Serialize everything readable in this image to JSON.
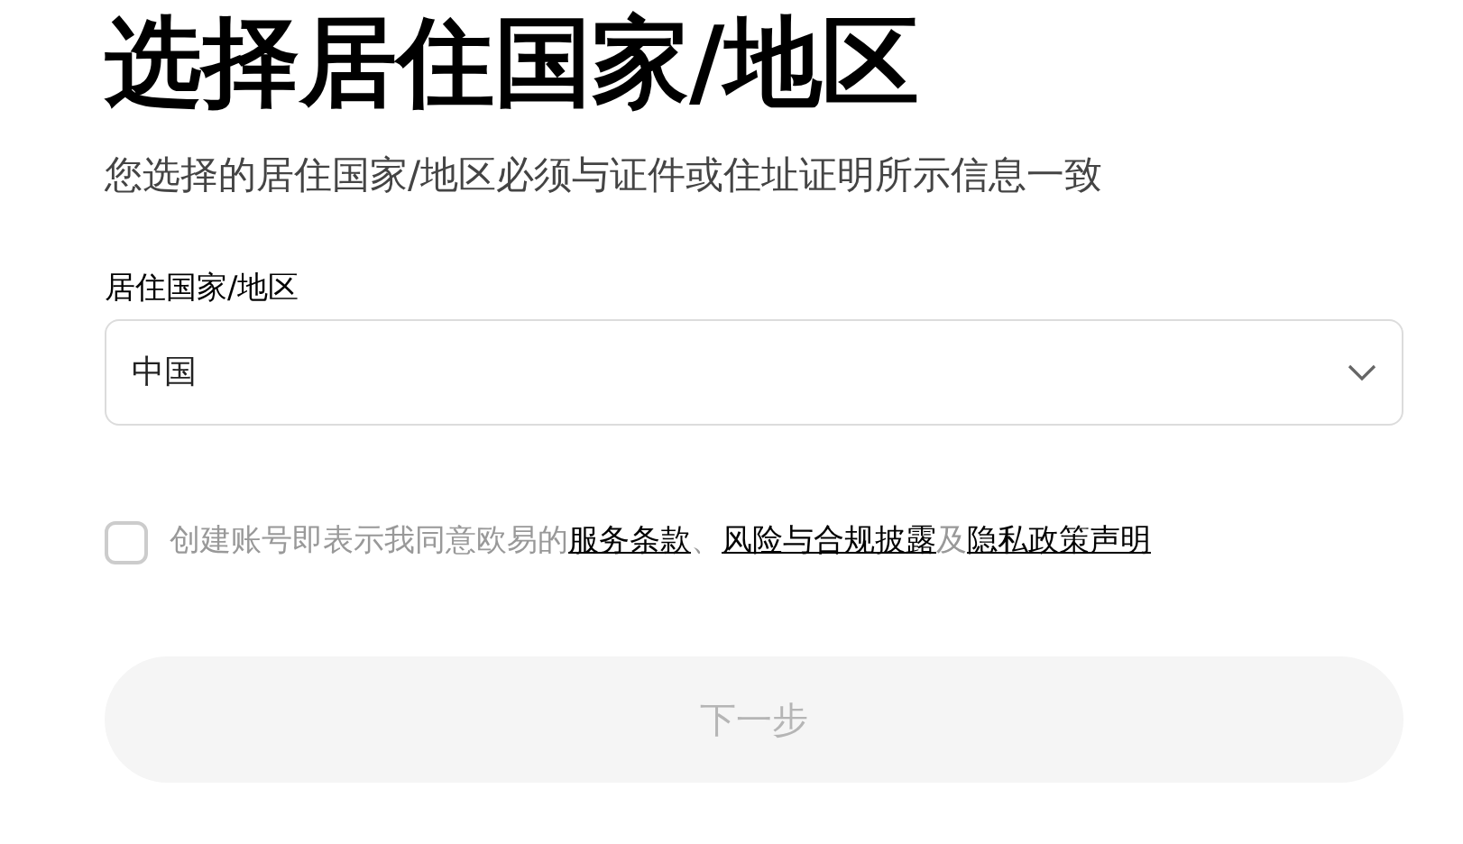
{
  "title": "选择居住国家/地区",
  "subtitle": "您选择的居住国家/地区必须与证件或住址证明所示信息一致",
  "country_field": {
    "label": "居住国家/地区",
    "value": "中国"
  },
  "agreement": {
    "checked": false,
    "parts": [
      {
        "kind": "text",
        "text": "创建账号即表示我同意欧易的"
      },
      {
        "kind": "link",
        "text": "服务条款"
      },
      {
        "kind": "text",
        "text": "、"
      },
      {
        "kind": "link",
        "text": "风险与合规披露"
      },
      {
        "kind": "text",
        "text": "及"
      },
      {
        "kind": "link",
        "text": "隐私政策声明"
      }
    ]
  },
  "next_button": {
    "label": "下一步",
    "disabled": true
  }
}
